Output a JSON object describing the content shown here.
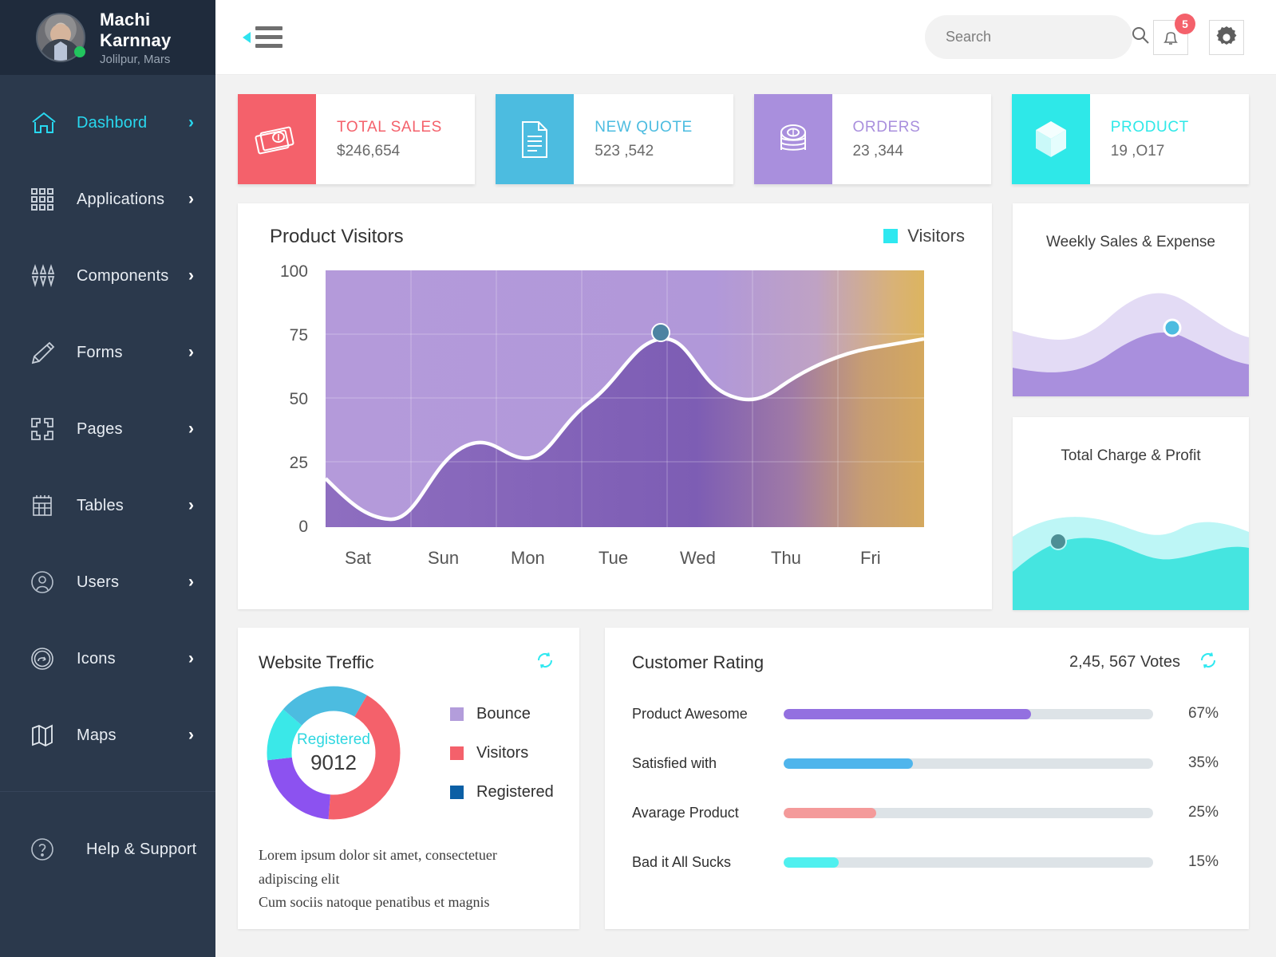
{
  "sidebar": {
    "profile": {
      "name": "Machi Karnnay",
      "location": "Jolilpur, Mars"
    },
    "items": [
      {
        "label": "Dashbord",
        "icon": "home-icon",
        "active": true,
        "chevron": "›"
      },
      {
        "label": "Applications",
        "icon": "grid-icon",
        "active": false,
        "chevron": "›"
      },
      {
        "label": "Components",
        "icon": "components-icon",
        "active": false,
        "chevron": "›"
      },
      {
        "label": "Forms",
        "icon": "pencil-icon",
        "active": false,
        "chevron": "›"
      },
      {
        "label": "Pages",
        "icon": "pages-icon",
        "active": false,
        "chevron": "›"
      },
      {
        "label": "Tables",
        "icon": "table-icon",
        "active": false,
        "chevron": "›"
      },
      {
        "label": "Users",
        "icon": "user-icon",
        "active": false,
        "chevron": "›"
      },
      {
        "label": "Icons",
        "icon": "icons-icon",
        "active": false,
        "chevron": "›"
      },
      {
        "label": "Maps",
        "icon": "map-icon",
        "active": false,
        "chevron": "›"
      }
    ],
    "help": {
      "label": "Help & Support",
      "icon": "question-circle-icon"
    }
  },
  "topbar": {
    "menu_toggle": "hamburger-icon",
    "search": {
      "placeholder": "Search",
      "value": ""
    },
    "notifications": {
      "count": "5"
    },
    "settings_icon": "gear-icon"
  },
  "stats": [
    {
      "title": "TOTAL SALES",
      "value": "$246,654",
      "color": "#f4616b",
      "icon": "money-icon"
    },
    {
      "title": "NEW QUOTE",
      "value": "523 ,542",
      "color": "#4cbce0",
      "icon": "document-icon"
    },
    {
      "title": "ORDERS",
      "value": "23 ,344",
      "color": "#a98fdd",
      "icon": "coins-icon"
    },
    {
      "title": "PRODUCT",
      "value": "19 ,O17",
      "color": "#2ee8e8",
      "icon": "box-icon"
    }
  ],
  "visitors": {
    "title": "Product Visitors",
    "legend_label": "Visitors",
    "legend_color": "#2ee8f0"
  },
  "weekly": {
    "title": "Weekly Sales & Expense"
  },
  "charge": {
    "title": "Total Charge & Profit"
  },
  "traffic": {
    "title": "Website Treffic",
    "refresh_icon": "refresh-icon",
    "center_label": "Registered",
    "center_value": "9012",
    "legend": [
      {
        "label": "Bounce",
        "color": "#b39ddb"
      },
      {
        "label": "Visitors",
        "color": "#f4616b"
      },
      {
        "label": "Registered",
        "color": "#0b5fa5"
      }
    ],
    "note_line1": "Lorem ipsum dolor sit amet, consectetuer adipiscing elit",
    "note_line2": "Cum sociis natoque penatibus et magnis"
  },
  "rating": {
    "title": "Customer Rating",
    "votes": "2,45, 567  Votes",
    "refresh_icon": "refresh-icon",
    "rows": [
      {
        "label": "Product Awesome",
        "pct": "67%",
        "value": 67,
        "color": "#9370e0"
      },
      {
        "label": "Satisfied with",
        "pct": "35%",
        "value": 35,
        "color": "#4fb5ec"
      },
      {
        "label": "Avarage Product",
        "pct": "25%",
        "value": 25,
        "color": "#f49a9a"
      },
      {
        "label": "Bad it All Sucks",
        "pct": "15%",
        "value": 15,
        "color": "#4ff0ef"
      }
    ]
  },
  "chart_data": [
    {
      "type": "area",
      "title": "Product Visitors",
      "categories": [
        "Sat",
        "Sun",
        "Mon",
        "Tue",
        "Wed",
        "Thu",
        "Fri"
      ],
      "series": [
        {
          "name": "Visitors",
          "values": [
            19,
            10,
            31,
            27,
            40,
            62,
            50
          ]
        }
      ],
      "ytick_labels": [
        "0",
        "25",
        "50",
        "75",
        "100"
      ],
      "ylim": [
        0,
        100
      ],
      "xlabel": "",
      "ylabel": "",
      "grid": true,
      "legend_position": "top-right",
      "marker": {
        "category": "Thu",
        "value": 62
      }
    },
    {
      "type": "area",
      "title": "Weekly Sales & Expense",
      "series": [
        {
          "name": "Sales",
          "values": [
            40,
            33,
            30,
            38,
            62,
            70,
            60,
            48
          ]
        },
        {
          "name": "Expense",
          "values": [
            22,
            18,
            16,
            22,
            42,
            52,
            45,
            35
          ]
        }
      ],
      "grid": false,
      "marker": {
        "value": 52
      }
    },
    {
      "type": "area",
      "title": "Total Charge & Profit",
      "series": [
        {
          "name": "Charge",
          "values": [
            46,
            58,
            60,
            52,
            42,
            38,
            52,
            58,
            50
          ]
        },
        {
          "name": "Profit",
          "values": [
            22,
            40,
            46,
            40,
            30,
            26,
            40,
            48,
            42
          ]
        }
      ],
      "grid": false,
      "marker": {
        "value": 40
      }
    },
    {
      "type": "pie",
      "title": "Website Treffic",
      "labels": [
        "Bounce",
        "Registered",
        "Visitors-light",
        "Visitors"
      ],
      "values": [
        22,
        13,
        22,
        43
      ],
      "colors": [
        "#8c52f0",
        "#3ae8e8",
        "#4cbce0",
        "#f4616b"
      ],
      "center_label": "Registered",
      "center_value": "9012"
    },
    {
      "type": "bar",
      "title": "Customer Rating",
      "categories": [
        "Product Awesome",
        "Satisfied with",
        "Avarage Product",
        "Bad it All Sucks"
      ],
      "values": [
        67,
        35,
        25,
        15
      ],
      "ylabel": "%",
      "ylim": [
        0,
        100
      ]
    }
  ]
}
